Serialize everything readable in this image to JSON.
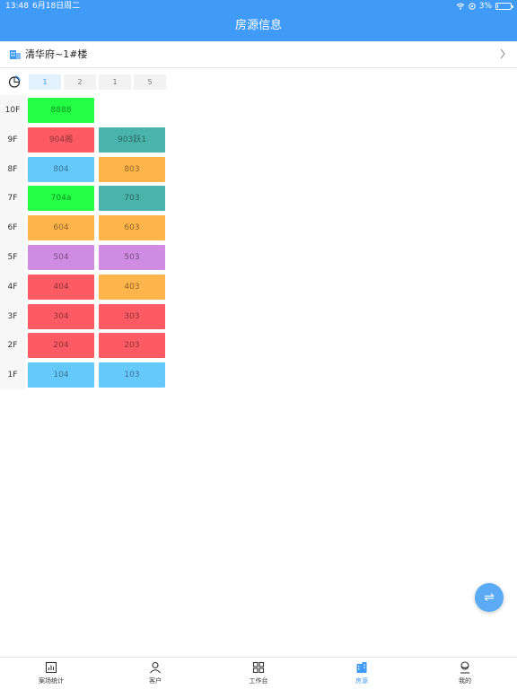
{
  "status_bar": {
    "time": "13:48",
    "date": "6月18日周二",
    "battery": "3%"
  },
  "header": {
    "title": "房源信息"
  },
  "project": {
    "name": "清华府~1#楼"
  },
  "units": [
    {
      "label": "1",
      "active": true
    },
    {
      "label": "2",
      "active": false
    },
    {
      "label": "1",
      "active": false
    },
    {
      "label": "5",
      "active": false
    }
  ],
  "floors": [
    {
      "floor": "10F",
      "rooms": [
        {
          "label": "8888",
          "color": "#22ff44"
        }
      ]
    },
    {
      "floor": "9F",
      "rooms": [
        {
          "label": "904阁",
          "color": "#fc5b63"
        },
        {
          "label": "903跃1",
          "color": "#4ab4ac"
        }
      ]
    },
    {
      "floor": "8F",
      "rooms": [
        {
          "label": "804",
          "color": "#66c9fc"
        },
        {
          "label": "803",
          "color": "#fdb44b"
        }
      ]
    },
    {
      "floor": "7F",
      "rooms": [
        {
          "label": "704a",
          "color": "#22ff44"
        },
        {
          "label": "703",
          "color": "#4ab4ac"
        }
      ]
    },
    {
      "floor": "6F",
      "rooms": [
        {
          "label": "604",
          "color": "#fdb44b"
        },
        {
          "label": "603",
          "color": "#fdb44b"
        }
      ]
    },
    {
      "floor": "5F",
      "rooms": [
        {
          "label": "504",
          "color": "#d08ce3"
        },
        {
          "label": "503",
          "color": "#d08ce3"
        }
      ]
    },
    {
      "floor": "4F",
      "rooms": [
        {
          "label": "404",
          "color": "#fc5b63"
        },
        {
          "label": "403",
          "color": "#fdb44b"
        }
      ]
    },
    {
      "floor": "3F",
      "rooms": [
        {
          "label": "304",
          "color": "#fc5b63"
        },
        {
          "label": "303",
          "color": "#fc5b63"
        }
      ]
    },
    {
      "floor": "2F",
      "rooms": [
        {
          "label": "204",
          "color": "#fc5b63"
        },
        {
          "label": "203",
          "color": "#fc5b63"
        }
      ]
    },
    {
      "floor": "1F",
      "rooms": [
        {
          "label": "104",
          "color": "#66c9fc"
        },
        {
          "label": "103",
          "color": "#66c9fc"
        }
      ]
    }
  ],
  "tabs": [
    {
      "label": "案场统计",
      "icon": "chart-icon",
      "active": false
    },
    {
      "label": "客户",
      "icon": "person-icon",
      "active": false
    },
    {
      "label": "工作台",
      "icon": "grid-icon",
      "active": false
    },
    {
      "label": "房源",
      "icon": "building-icon",
      "active": true
    },
    {
      "label": "我的",
      "icon": "profile-icon",
      "active": false
    }
  ],
  "colors": {
    "accent": "#3f9bf7"
  }
}
